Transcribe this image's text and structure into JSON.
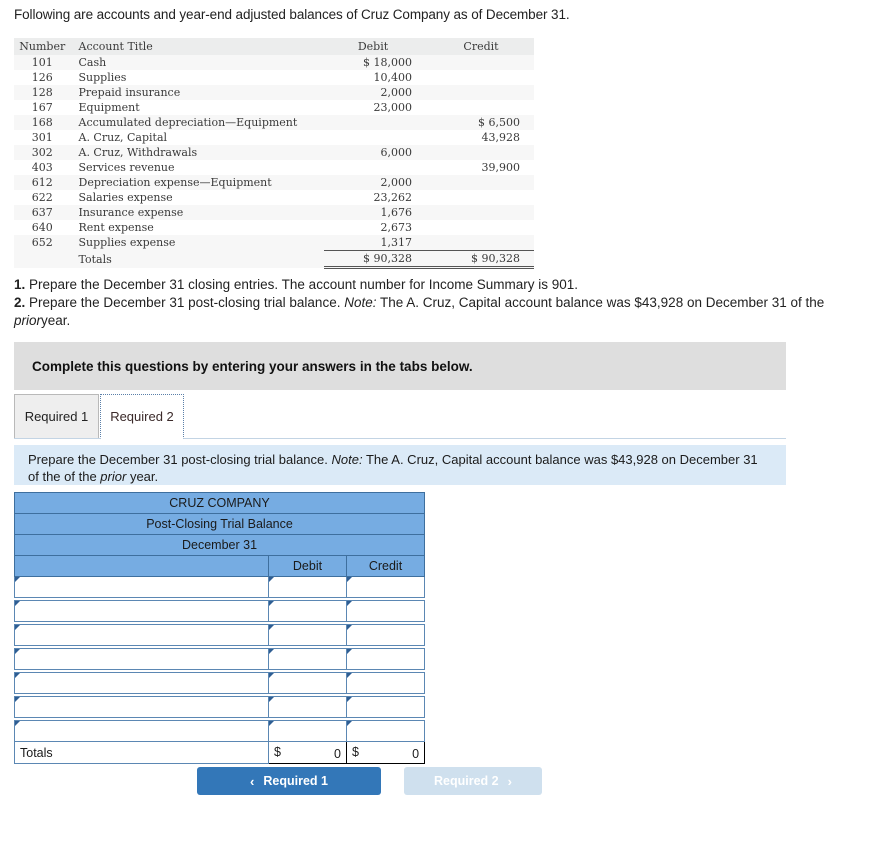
{
  "intro": "Following are accounts and year-end adjusted balances of Cruz Company as of December 31.",
  "trial_balance": {
    "headers": {
      "number": "Number",
      "account_title": "Account Title",
      "debit": "Debit",
      "credit": "Credit"
    },
    "rows": [
      {
        "number": "101",
        "title": "Cash",
        "debit": "$ 18,000",
        "credit": ""
      },
      {
        "number": "126",
        "title": "Supplies",
        "debit": "10,400",
        "credit": ""
      },
      {
        "number": "128",
        "title": "Prepaid insurance",
        "debit": "2,000",
        "credit": ""
      },
      {
        "number": "167",
        "title": "Equipment",
        "debit": "23,000",
        "credit": ""
      },
      {
        "number": "168",
        "title": "Accumulated depreciation—Equipment",
        "debit": "",
        "credit": "$ 6,500"
      },
      {
        "number": "301",
        "title": "A. Cruz, Capital",
        "debit": "",
        "credit": "43,928"
      },
      {
        "number": "302",
        "title": "A. Cruz, Withdrawals",
        "debit": "6,000",
        "credit": ""
      },
      {
        "number": "403",
        "title": "Services revenue",
        "debit": "",
        "credit": "39,900"
      },
      {
        "number": "612",
        "title": "Depreciation expense—Equipment",
        "debit": "2,000",
        "credit": ""
      },
      {
        "number": "622",
        "title": "Salaries expense",
        "debit": "23,262",
        "credit": ""
      },
      {
        "number": "637",
        "title": "Insurance expense",
        "debit": "1,676",
        "credit": ""
      },
      {
        "number": "640",
        "title": "Rent expense",
        "debit": "2,673",
        "credit": ""
      },
      {
        "number": "652",
        "title": "Supplies expense",
        "debit": "1,317",
        "credit": ""
      }
    ],
    "totals": {
      "label": "Totals",
      "debit": "$ 90,328",
      "credit": "$ 90,328"
    }
  },
  "requirements": {
    "item1_num": "1.",
    "item1_text": "Prepare the December 31 closing entries. The account number for Income Summary is 901.",
    "item2_num": "2.",
    "item2_a": "Prepare the December 31 post-closing trial balance.",
    "item2_note": "Note:",
    "item2_b": "The A. Cruz, Capital account balance was $43,928 on December 31 of the",
    "item2_italic": "prior",
    "item2_c": "year."
  },
  "banner": {
    "text": "Complete this questions by entering your answers in the tabs below."
  },
  "tabs": [
    {
      "label": "Required 1",
      "active": false
    },
    {
      "label": "Required 2",
      "active": true
    }
  ],
  "panel": {
    "a": "Prepare the December 31 post-closing trial balance.",
    "note": "Note:",
    "b": "The A. Cruz, Capital account balance was $43,928 on December 31 of the",
    "italic": "prior",
    "c": "year."
  },
  "answer_table": {
    "company": "CRUZ COMPANY",
    "statement": "Post-Closing Trial Balance",
    "period": "December 31",
    "col_blank": "",
    "col_debit": "Debit",
    "col_credit": "Credit",
    "entry_rows": 7,
    "totals": {
      "label": "Totals",
      "debit_symbol": "$",
      "debit_value": "0",
      "credit_symbol": "$",
      "credit_value": "0"
    }
  },
  "nav": {
    "prev_label": "Required 1",
    "prev_chevron": "‹",
    "next_label": "Required 2",
    "next_chevron": "›"
  },
  "colors": {
    "primary_button": "#3377b8",
    "disabled_button": "#cfe0ee",
    "table_header_blue": "#76ace2",
    "panel_blue": "#dbeaf7",
    "banner_gray": "#dedede",
    "cell_border": "#3e6f9e"
  }
}
